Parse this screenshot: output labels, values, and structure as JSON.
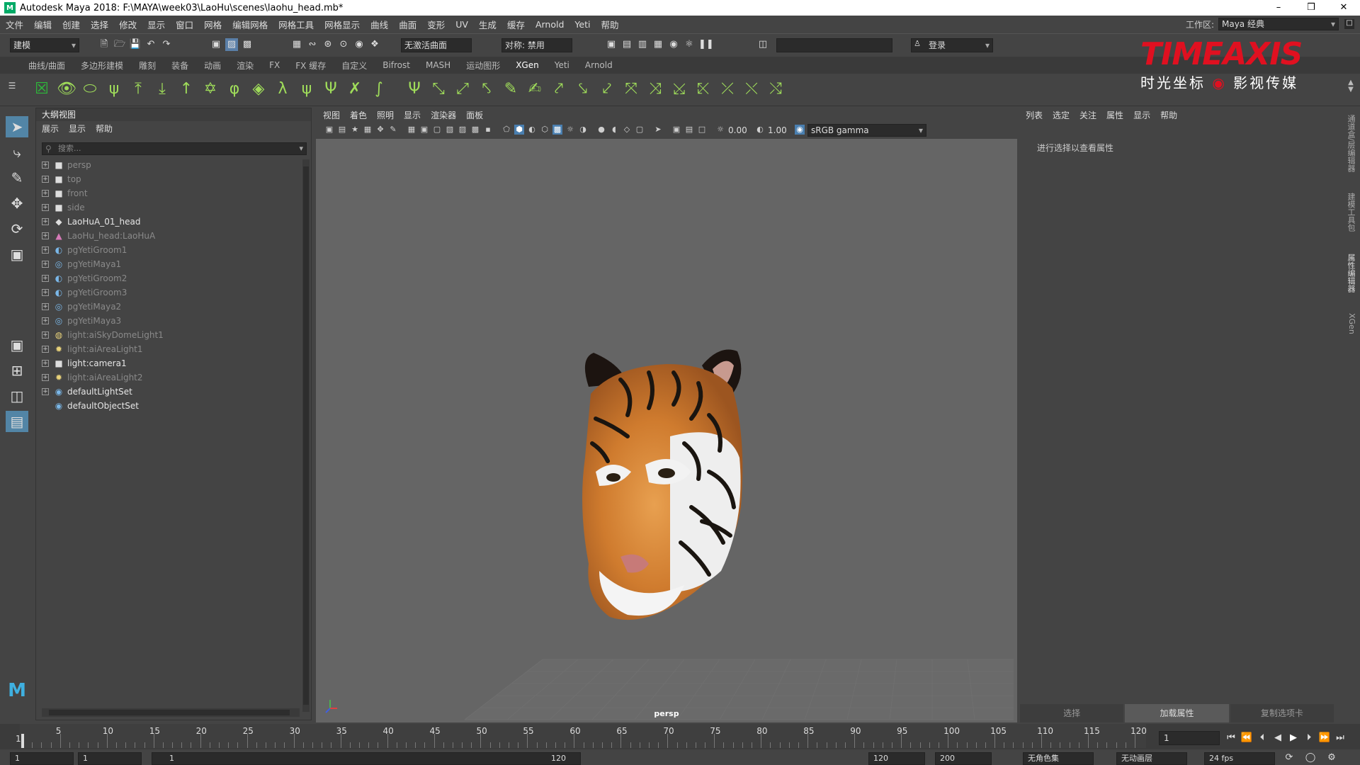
{
  "title": "Autodesk Maya 2018: F:\\MAYA\\week03\\LaoHu\\scenes\\laohu_head.mb*",
  "app_icon": "M",
  "window_buttons": [
    "–",
    "❒",
    "✕"
  ],
  "menus": [
    "文件",
    "编辑",
    "创建",
    "选择",
    "修改",
    "显示",
    "窗口",
    "网格",
    "编辑网格",
    "网格工具",
    "网格显示",
    "曲线",
    "曲面",
    "变形",
    "UV",
    "生成",
    "缓存",
    "Arnold",
    "Yeti",
    "帮助"
  ],
  "workspace": {
    "label": "工作区:",
    "value": "Maya 经典"
  },
  "statusline": {
    "mode": "建模",
    "live_surface": "无激活曲面",
    "symmetry": "对称: 禁用",
    "login": "登录"
  },
  "shelf_tabs": [
    "曲线/曲面",
    "多边形建模",
    "雕刻",
    "装备",
    "动画",
    "渲染",
    "FX",
    "FX 缓存",
    "自定义",
    "Bifrost",
    "MASH",
    "运动图形",
    "XGen",
    "Yeti",
    "Arnold"
  ],
  "shelf_active": "XGen",
  "logo": {
    "brand": "TIMEAXIS",
    "tagline_left": "时光坐标",
    "tagline_right": "影视传媒",
    "color": "#e01020"
  },
  "outliner": {
    "title": "大纲视图",
    "menu": [
      "展示",
      "显示",
      "帮助"
    ],
    "search_placeholder": "搜索...",
    "items": [
      {
        "label": "persp",
        "icon": "camera-icon",
        "dim": true
      },
      {
        "label": "top",
        "icon": "camera-icon",
        "dim": true
      },
      {
        "label": "front",
        "icon": "camera-icon",
        "dim": true
      },
      {
        "label": "side",
        "icon": "camera-icon",
        "dim": true
      },
      {
        "label": "LaoHuA_01_head",
        "icon": "group-icon",
        "dim": false
      },
      {
        "label": "LaoHu_head:LaoHuA",
        "icon": "mesh-icon",
        "dim": true
      },
      {
        "label": "pgYetiGroom1",
        "icon": "yeti-groom-icon",
        "dim": true
      },
      {
        "label": "pgYetiMaya1",
        "icon": "yeti-node-icon",
        "dim": true
      },
      {
        "label": "pgYetiGroom2",
        "icon": "yeti-groom-icon",
        "dim": true
      },
      {
        "label": "pgYetiGroom3",
        "icon": "yeti-groom-icon",
        "dim": true
      },
      {
        "label": "pgYetiMaya2",
        "icon": "yeti-node-icon",
        "dim": true
      },
      {
        "label": "pgYetiMaya3",
        "icon": "yeti-node-icon",
        "dim": true
      },
      {
        "label": "light:aiSkyDomeLight1",
        "icon": "skydome-icon",
        "dim": true
      },
      {
        "label": "light:aiAreaLight1",
        "icon": "light-icon",
        "dim": true
      },
      {
        "label": "light:camera1",
        "icon": "camera-icon",
        "dim": false
      },
      {
        "label": "light:aiAreaLight2",
        "icon": "light-icon",
        "dim": true
      },
      {
        "label": "defaultLightSet",
        "icon": "set-icon",
        "dim": false
      },
      {
        "label": "defaultObjectSet",
        "icon": "set-icon",
        "dim": false
      }
    ]
  },
  "viewport": {
    "menu": [
      "视图",
      "着色",
      "照明",
      "显示",
      "渲染器",
      "面板"
    ],
    "exposure": "0.00",
    "gamma": "1.00",
    "color_space": "sRGB gamma",
    "camera": "persp"
  },
  "attribute_editor": {
    "menu": [
      "列表",
      "选定",
      "关注",
      "属性",
      "显示",
      "帮助"
    ],
    "hint": "进行选择以查看属性",
    "buttons": [
      "选择",
      "加载属性",
      "复制选项卡"
    ],
    "active_button": "加载属性"
  },
  "side_tabs": [
    "通道盒/层编辑器",
    "建模工具包",
    "属性编辑器",
    "XGen"
  ],
  "timeline": {
    "start_frame": "1",
    "ticks": [
      "5",
      "10",
      "15",
      "20",
      "25",
      "30",
      "35",
      "40",
      "45",
      "50",
      "55",
      "60",
      "65",
      "70",
      "75",
      "80",
      "85",
      "90",
      "95",
      "100",
      "105",
      "110",
      "115",
      "120"
    ],
    "current_frame": "1",
    "playback_buttons": [
      "⏮",
      "⏪",
      "⏴",
      "◀",
      "▶",
      "⏵",
      "⏩",
      "⏭"
    ]
  },
  "range": {
    "start": "1",
    "start2": "1",
    "slider_start": "1",
    "slider_end": "120",
    "end": "120",
    "end2": "200",
    "character_set": "无角色集",
    "anim_layer": "无动画层",
    "fps": "24 fps"
  }
}
